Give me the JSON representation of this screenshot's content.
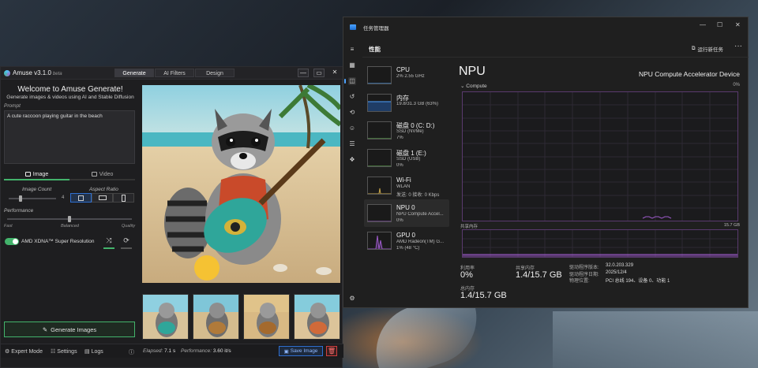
{
  "amuse": {
    "title": "Amuse v3.1.0",
    "title_suffix": "beta",
    "tabs": [
      "Generate",
      "AI Filters",
      "Design"
    ],
    "window_controls": [
      "—",
      "▭",
      "✕"
    ],
    "welcome_title": "Welcome to Amuse Generate!",
    "welcome_subtitle": "Generate images & videos using AI and Stable Diffusion",
    "prompt_label": "Prompt",
    "prompt_value": "A cute raccoon playing guitar in the beach",
    "mode_image": "Image",
    "mode_video": "Video",
    "image_count_label": "Image Count",
    "image_count_value": "4",
    "image_count_level": 0.25,
    "aspect_ratio_label": "Aspect Ratio",
    "performance_label": "Performance",
    "performance_ticks": [
      "Fast",
      "Balanced",
      "Quality"
    ],
    "performance_level": 0.5,
    "xdna_label": "AMD XDNA™ Super Resolution",
    "generate_label": "Generate Images",
    "status": {
      "expert_mode": "Expert Mode",
      "settings": "Settings",
      "logs": "Logs",
      "elapsed_label": "Elapsed:",
      "elapsed_value": "7.1 s",
      "performance_label": "Performance:",
      "performance_value": "3.60 it/s",
      "save_label": "Save Image"
    },
    "accent": "#43b36b"
  },
  "taskmanager": {
    "title": "任务管理器",
    "section": "性能",
    "run_task": "运行新任务",
    "items": [
      {
        "name": "CPU",
        "sub1": "2% 2.55 GHz",
        "sub2": ""
      },
      {
        "name": "内存",
        "sub1": "19.8/31.3 GB (63%)",
        "sub2": ""
      },
      {
        "name": "磁盘 0 (C: D:)",
        "sub1": "SSD (NVMe)",
        "sub2": "7%"
      },
      {
        "name": "磁盘 1 (E:)",
        "sub1": "SSD (USB)",
        "sub2": "0%"
      },
      {
        "name": "Wi-Fi",
        "sub1": "WLAN",
        "sub2": "发送: 0 接收: 0 Kbps"
      },
      {
        "name": "NPU 0",
        "sub1": "NPU Compute Accel...",
        "sub2": "0%"
      },
      {
        "name": "GPU 0",
        "sub1": "AMD Radeon(TM) G...",
        "sub2": "1% (48 °C)"
      }
    ],
    "npu": {
      "heading": "NPU",
      "device": "NPU Compute Accelerator Device",
      "compute_label": "Compute",
      "compute_pct": "0%",
      "shared_mem_label": "共享内存",
      "shared_mem_max": "15.7 GB",
      "utilization_label": "利用率",
      "utilization_value": "0%",
      "shared_label": "共享内存",
      "shared_value": "1.4/15.7 GB",
      "total_label": "总内存",
      "total_value": "1.4/15.7 GB",
      "info": [
        {
          "k": "驱动程序版本:",
          "v": "32.0.203.329"
        },
        {
          "k": "驱动程序日期:",
          "v": "2025/12/4"
        },
        {
          "k": "物理位置:",
          "v": "PCI 总线 194、设备 0、功能 1"
        }
      ]
    },
    "graph_color": "#9b59c8"
  }
}
